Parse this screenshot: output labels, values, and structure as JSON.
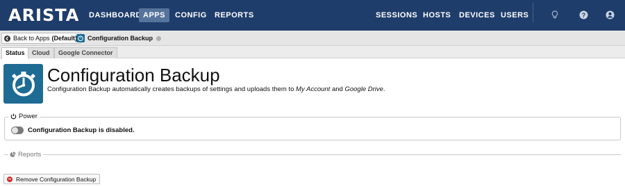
{
  "brand": {
    "logo_text": "ARISTA"
  },
  "nav": {
    "left": [
      {
        "label": "DASHBOARD",
        "active": false
      },
      {
        "label": "APPS",
        "active": true
      },
      {
        "label": "CONFIG",
        "active": false
      },
      {
        "label": "REPORTS",
        "active": false
      }
    ],
    "right": [
      {
        "label": "SESSIONS"
      },
      {
        "label": "HOSTS"
      },
      {
        "label": "DEVICES"
      },
      {
        "label": "USERS"
      }
    ],
    "icons": [
      "lightbulb-icon",
      "help-icon",
      "account-icon"
    ]
  },
  "breadcrumb": {
    "back_label": "Back to Apps",
    "back_policy": "(Default)",
    "app_name": "Configuration Backup"
  },
  "tabs": [
    {
      "label": "Status",
      "active": true
    },
    {
      "label": "Cloud",
      "active": false
    },
    {
      "label": "Google Connector",
      "active": false
    }
  ],
  "app": {
    "title": "Configuration Backup",
    "description_prefix": "Configuration Backup automatically creates backups of settings and uploads them to ",
    "description_link1": "My Account",
    "description_mid": " and ",
    "description_link2": "Google Drive",
    "description_suffix": "."
  },
  "power": {
    "legend": "Power",
    "status_text": "Configuration Backup is disabled.",
    "enabled": false
  },
  "reports": {
    "legend": "Reports"
  },
  "actions": {
    "remove_label": "Remove Configuration Backup"
  },
  "colors": {
    "nav_bg": "#1f3d6b",
    "nav_active": "#56739c",
    "app_icon_bg": "#1e6b94",
    "remove_red": "#d32f2f"
  }
}
